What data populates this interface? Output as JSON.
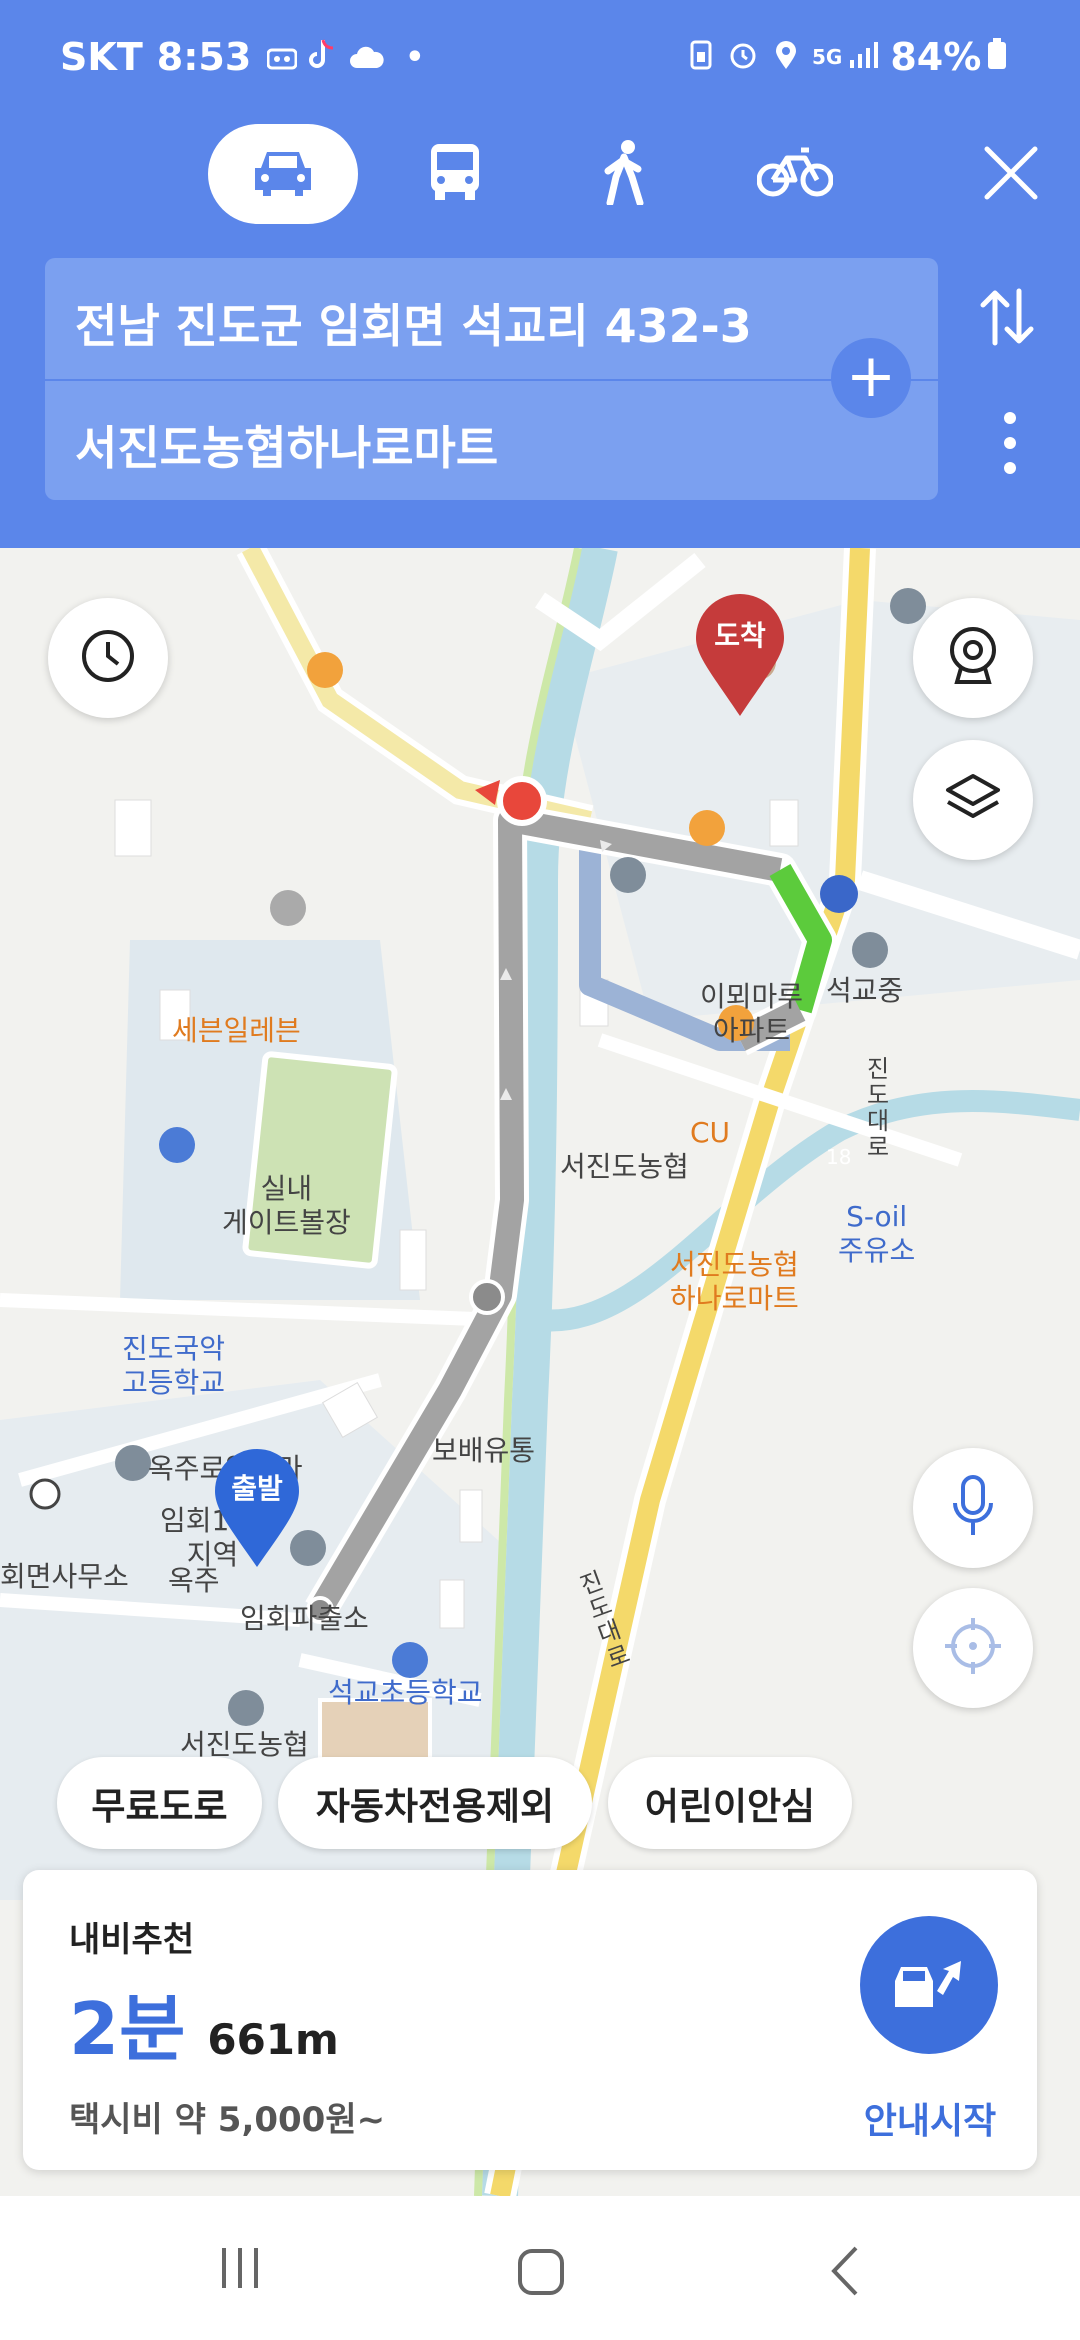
{
  "status_bar": {
    "carrier": "SKT",
    "time": "8:53",
    "battery": "84%",
    "network": "5G"
  },
  "transport_modes": [
    {
      "name": "car",
      "icon": "car-icon",
      "active": true
    },
    {
      "name": "bus",
      "icon": "bus-icon",
      "active": false
    },
    {
      "name": "walk",
      "icon": "walk-icon",
      "active": false
    },
    {
      "name": "bike",
      "icon": "bike-icon",
      "active": false
    }
  ],
  "route": {
    "origin": "전남 진도군 임회면 석교리 432-3",
    "destination": "서진도농협하나로마트"
  },
  "map": {
    "labels": {
      "seven_eleven": "세븐일레븐",
      "imae_apt": "이뫼마루\n아파트",
      "seokgyo_mid": "석교중",
      "jindo_daero_1": "진도대로",
      "cu": "CU",
      "nh_bank": "서진도농협",
      "route_num": "18",
      "soil": "S-oil\n주유소",
      "nh_mart": "서진도농협\n하나로마트",
      "indoor_gate": "실내\n게이트볼장",
      "gukak_school": "진도국악\n고등학교",
      "bobae": "보배유통",
      "okjuro_villa": "옥주로얄빌라",
      "imhoe119": "임회119\n지역",
      "myeon_office": "회면사무소",
      "okju": "옥주",
      "police": "임회파출소",
      "jindo_daero_2": "진도대로",
      "seokgyo_elem": "석교초등학교",
      "nh_bottom": "서진도농협"
    },
    "markers": {
      "start": "출발",
      "arrival": "도착"
    }
  },
  "filters": [
    "무료도로",
    "자동차전용제외",
    "어린이안심"
  ],
  "summary": {
    "heading": "내비추천",
    "duration": "2분",
    "distance": "661m",
    "taxi_fare": "택시비 약 5,000원~",
    "start_button": "안내시작"
  },
  "colors": {
    "header": "#5b86ea",
    "accent": "#3d6fdc",
    "route": "#a3a3a3",
    "congestion_free": "#5ccb3c",
    "arrival_pin": "#c53b3b",
    "start_pin": "#2f68d8"
  }
}
